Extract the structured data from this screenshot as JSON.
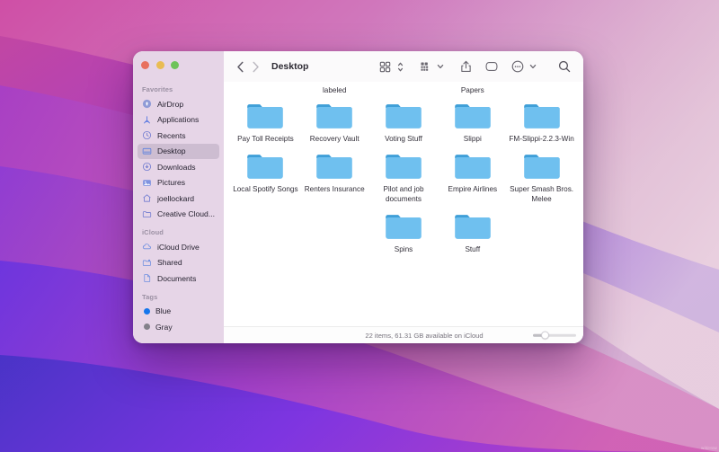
{
  "window": {
    "title": "Desktop",
    "traffic_lights": [
      {
        "name": "close",
        "color": "#e8705f"
      },
      {
        "name": "minimize",
        "color": "#e9bc53"
      },
      {
        "name": "maximize",
        "color": "#6ec35a"
      }
    ]
  },
  "toolbar": {
    "back_label": "‹",
    "forward_label": "›",
    "buttons": [
      {
        "name": "view-grid-button",
        "icon": "grid-icon"
      },
      {
        "name": "view-stepper",
        "icon": "chevron-updown-icon"
      },
      {
        "name": "group-by-button",
        "icon": "group-grid-icon"
      },
      {
        "name": "group-by-chevron",
        "icon": "chevron-down-icon"
      },
      {
        "name": "share-button",
        "icon": "share-icon"
      },
      {
        "name": "tag-button",
        "icon": "tag-icon"
      },
      {
        "name": "actions-button",
        "icon": "more-circle-icon"
      },
      {
        "name": "actions-chevron",
        "icon": "chevron-down-icon"
      },
      {
        "name": "search-button",
        "icon": "search-icon"
      }
    ]
  },
  "sidebar": {
    "sections": [
      {
        "title": "Favorites",
        "items": [
          {
            "label": "AirDrop",
            "icon": "airdrop-icon",
            "selected": false
          },
          {
            "label": "Applications",
            "icon": "applications-icon",
            "selected": false
          },
          {
            "label": "Recents",
            "icon": "clock-icon",
            "selected": false
          },
          {
            "label": "Desktop",
            "icon": "desktop-icon",
            "selected": true
          },
          {
            "label": "Downloads",
            "icon": "download-icon",
            "selected": false
          },
          {
            "label": "Pictures",
            "icon": "pictures-icon",
            "selected": false
          },
          {
            "label": "joellockard",
            "icon": "home-icon",
            "selected": false
          },
          {
            "label": "Creative Cloud...",
            "icon": "folder-icon",
            "selected": false
          }
        ]
      },
      {
        "title": "iCloud",
        "items": [
          {
            "label": "iCloud Drive",
            "icon": "cloud-icon",
            "selected": false
          },
          {
            "label": "Shared",
            "icon": "shared-folder-icon",
            "selected": false
          },
          {
            "label": "Documents",
            "icon": "document-icon",
            "selected": false
          }
        ]
      },
      {
        "title": "Tags",
        "items": [
          {
            "label": "Blue",
            "icon": "tag-dot-icon",
            "color": "#1576ec",
            "selected": false
          },
          {
            "label": "Gray",
            "icon": "tag-dot-icon",
            "color": "#83818a",
            "selected": false
          }
        ]
      }
    ]
  },
  "content": {
    "clipped_row_labels": [
      "",
      "labeled",
      "",
      "Papers",
      ""
    ],
    "rows": [
      [
        {
          "name": "Pay Toll Receipts",
          "type": "folder"
        },
        {
          "name": "Recovery Vault",
          "type": "folder"
        },
        {
          "name": "Voting Stuff",
          "type": "folder"
        },
        {
          "name": "Slippi",
          "type": "folder"
        },
        {
          "name": "FM-Slippi-2.2.3-Win",
          "type": "folder"
        }
      ],
      [
        {
          "name": "Local Spotify Songs",
          "type": "folder"
        },
        {
          "name": "Renters Insurance",
          "type": "folder"
        },
        {
          "name": "Pilot and job documents",
          "type": "folder"
        },
        {
          "name": "Empire Airlines",
          "type": "folder"
        },
        {
          "name": "Super Smash Bros. Melee",
          "type": "folder"
        }
      ],
      [
        {
          "name": "",
          "type": "empty"
        },
        {
          "name": "",
          "type": "empty"
        },
        {
          "name": "Spins",
          "type": "folder"
        },
        {
          "name": "Stuff",
          "type": "folder"
        },
        {
          "name": "",
          "type": "empty"
        }
      ]
    ]
  },
  "statusbar": {
    "text": "22 items, 61.31 GB available on iCloud",
    "zoom_value": "20"
  },
  "colors": {
    "folder_light": "#6fc0ef",
    "folder_dark": "#3f9fd8",
    "sidebar_bg": "#e6d5e7",
    "accent_blue": "#1576ec"
  }
}
